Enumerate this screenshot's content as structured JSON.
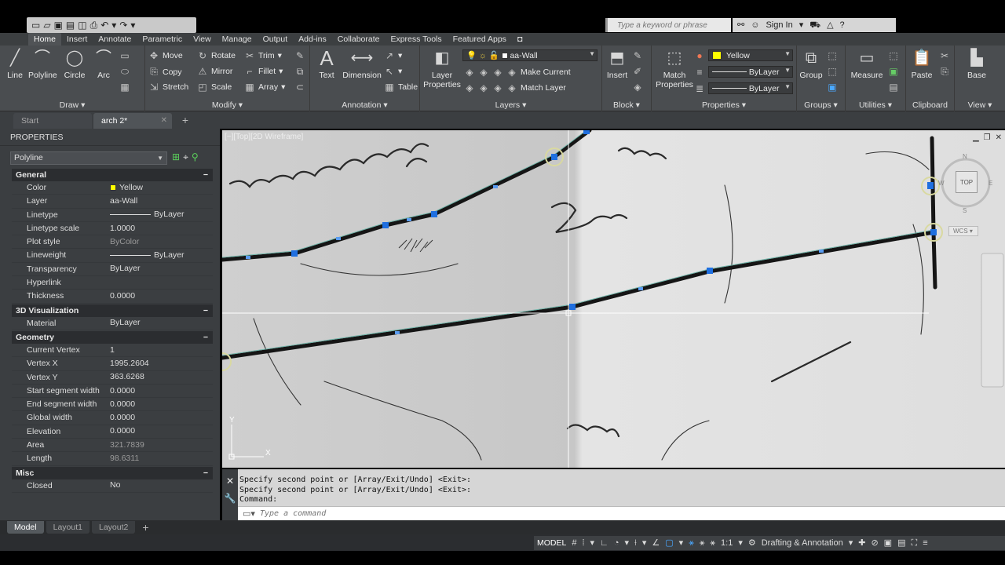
{
  "search": {
    "placeholder": "Type a keyword or phrase"
  },
  "account": {
    "sign_in": "Sign In"
  },
  "ribbon_tabs": [
    "Home",
    "Insert",
    "Annotate",
    "Parametric",
    "View",
    "Manage",
    "Output",
    "Add-ins",
    "Collaborate",
    "Express Tools",
    "Featured Apps"
  ],
  "ribbon": {
    "draw": {
      "title": "Draw",
      "line": "Line",
      "polyline": "Polyline",
      "circle": "Circle",
      "arc": "Arc"
    },
    "modify": {
      "title": "Modify",
      "move": "Move",
      "rotate": "Rotate",
      "trim": "Trim",
      "copy": "Copy",
      "mirror": "Mirror",
      "fillet": "Fillet",
      "stretch": "Stretch",
      "scale": "Scale",
      "array": "Array"
    },
    "annotation": {
      "title": "Annotation",
      "text": "Text",
      "dimension": "Dimension",
      "table": "Table"
    },
    "layers": {
      "title": "Layers",
      "layer_properties": "Layer\nProperties",
      "current_layer": "aa-Wall",
      "make_current": "Make Current",
      "match_layer": "Match Layer"
    },
    "block": {
      "title": "Block",
      "insert": "Insert"
    },
    "properties": {
      "title": "Properties",
      "match_properties": "Match\nProperties",
      "color": "Yellow",
      "linetype": "ByLayer",
      "lineweight": "ByLayer"
    },
    "groups": {
      "title": "Groups",
      "group": "Group"
    },
    "utilities": {
      "title": "Utilities",
      "measure": "Measure"
    },
    "clipboard": {
      "title": "Clipboard",
      "paste": "Paste"
    },
    "view": {
      "title": "View",
      "base": "Base"
    }
  },
  "doc_tabs": {
    "start": "Start",
    "active": "arch 2*"
  },
  "properties_palette": {
    "title": "PROPERTIES",
    "object_type": "Polyline",
    "general": {
      "title": "General",
      "rows": [
        {
          "k": "Color",
          "v": "Yellow"
        },
        {
          "k": "Layer",
          "v": "aa-Wall"
        },
        {
          "k": "Linetype",
          "v": "ByLayer"
        },
        {
          "k": "Linetype scale",
          "v": "1.0000"
        },
        {
          "k": "Plot style",
          "v": "ByColor"
        },
        {
          "k": "Lineweight",
          "v": "ByLayer"
        },
        {
          "k": "Transparency",
          "v": "ByLayer"
        },
        {
          "k": "Hyperlink",
          "v": ""
        },
        {
          "k": "Thickness",
          "v": "0.0000"
        }
      ]
    },
    "visualization": {
      "title": "3D Visualization",
      "rows": [
        {
          "k": "Material",
          "v": "ByLayer"
        }
      ]
    },
    "geometry": {
      "title": "Geometry",
      "rows": [
        {
          "k": "Current Vertex",
          "v": "1"
        },
        {
          "k": "Vertex X",
          "v": "1995.2604"
        },
        {
          "k": "Vertex Y",
          "v": "363.6268"
        },
        {
          "k": "Start segment width",
          "v": "0.0000"
        },
        {
          "k": "End segment width",
          "v": "0.0000"
        },
        {
          "k": "Global width",
          "v": "0.0000"
        },
        {
          "k": "Elevation",
          "v": "0.0000"
        },
        {
          "k": "Area",
          "v": "321.7839"
        },
        {
          "k": "Length",
          "v": "98.6311"
        }
      ]
    },
    "misc": {
      "title": "Misc",
      "rows": [
        {
          "k": "Closed",
          "v": "No"
        }
      ]
    }
  },
  "viewport": {
    "label": "[−][Top][2D Wireframe]",
    "viewcube_face": "TOP",
    "wcs": "WCS",
    "compass": {
      "n": "N",
      "s": "S",
      "e": "E",
      "w": "W"
    }
  },
  "command_line": {
    "history": [
      "Specify second point or [Array/Exit/Undo] <Exit>:",
      "Specify second point or [Array/Exit/Undo] <Exit>:",
      "Command:"
    ],
    "placeholder": "Type a command"
  },
  "layout_tabs": [
    "Model",
    "Layout1",
    "Layout2"
  ],
  "status_bar": {
    "model": "MODEL",
    "scale": "1:1",
    "workspace": "Drafting & Annotation"
  },
  "colors": {
    "accent": "#4aa8ff",
    "selection": "#1e6ee6",
    "polyline": "#1a1a1a",
    "grip": "#1f6fe0"
  },
  "icons": [
    "new-icon",
    "open-icon",
    "save-icon",
    "plot-icon",
    "undo-icon",
    "redo-icon",
    "search-icon",
    "user-icon",
    "cart-icon",
    "help-icon",
    "line-icon",
    "polyline-icon",
    "circle-icon",
    "arc-icon",
    "move-icon",
    "rotate-icon",
    "trim-icon",
    "copy-icon",
    "mirror-icon",
    "fillet-icon",
    "stretch-icon",
    "scale-icon",
    "array-icon",
    "text-icon",
    "dimension-icon",
    "table-icon",
    "layer-icon",
    "insert-icon",
    "match-properties-icon",
    "group-icon",
    "measure-icon",
    "paste-icon",
    "base-icon",
    "close-icon",
    "wrench-icon",
    "gear-icon",
    "fullscreen-icon"
  ]
}
